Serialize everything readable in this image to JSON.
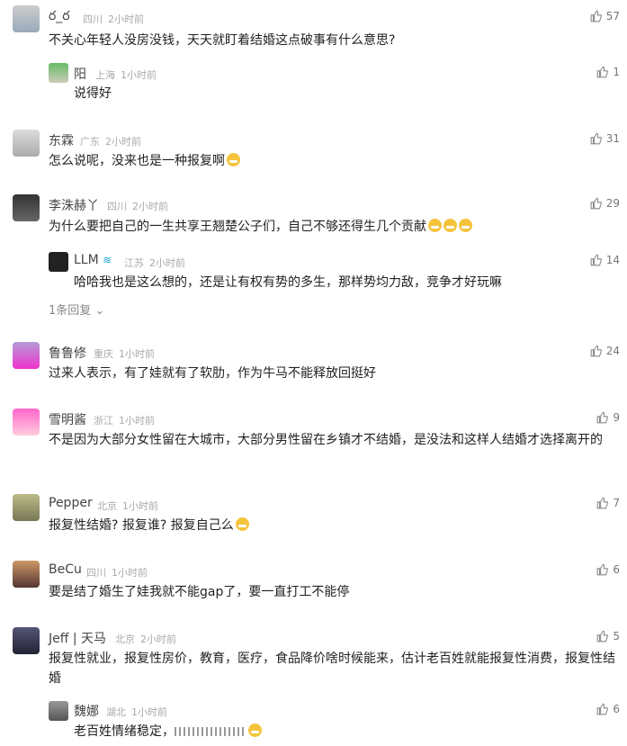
{
  "comments": [
    {
      "name": "ర_ర",
      "location": "四川",
      "time": "2小时前",
      "likes": "57",
      "text": "不关心年轻人没房没钱，天天就盯着结婚这点破事有什么意思?",
      "replies": [
        {
          "name": "阳",
          "location": "上海",
          "time": "1小时前",
          "likes": "1",
          "text": "说得好"
        }
      ]
    },
    {
      "name": "东霖",
      "location": "广东",
      "time": "2小时前",
      "likes": "31",
      "text": "怎么说呢，没来也是一种报复啊"
    },
    {
      "name": "李洙赫丫",
      "location": "四川",
      "time": "2小时前",
      "likes": "29",
      "text": "为什么要把自己的一生共享王翘楚公子们，自己不够还得生几个贡献",
      "replies": [
        {
          "name": "LLM",
          "location": "江苏",
          "time": "2小时前",
          "likes": "14",
          "text": "哈哈我也是这么想的，还是让有权有势的多生，那样势均力敌，竞争才好玩嘛"
        }
      ],
      "more_replies": "1条回复"
    },
    {
      "name": "鲁鲁修",
      "location": "重庆",
      "time": "1小时前",
      "likes": "24",
      "text": "过来人表示，有了娃就有了软肋，作为牛马不能释放回挺好"
    },
    {
      "name": "雪明酱",
      "location": "浙江",
      "time": "1小时前",
      "likes": "9",
      "text": "不是因为大部分女性留在大城市，大部分男性留在乡镇才不结婚，是没法和这样人结婚才选择离开的"
    },
    {
      "name": "Pepper",
      "location": "北京",
      "time": "1小时前",
      "likes": "7",
      "text": "报复性结婚? 报复谁? 报复自己么"
    },
    {
      "name": "BeCu",
      "location": "四川",
      "time": "1小时前",
      "likes": "6",
      "text": "要是结了婚生了娃我就不能gap了，要一直打工不能停"
    },
    {
      "name": "Jeff | 天马",
      "location": "北京",
      "time": "2小时前",
      "likes": "5",
      "text": "报复性就业，报复性房价，教育，医疗，食品降价啥时候能来，估计老百姓就能报复性消费，报复性结婚",
      "replies": [
        {
          "name": "魏娜",
          "location": "湖北",
          "time": "1小时前",
          "likes": "6",
          "text": "老百姓情绪稳定，"
        }
      ]
    }
  ],
  "colors": {
    "text": "#222222",
    "meta": "#aaaaaa",
    "likes": "#777777"
  },
  "icons": {
    "like": "thumbs-up-icon",
    "expand": "chevron-down-icon"
  }
}
